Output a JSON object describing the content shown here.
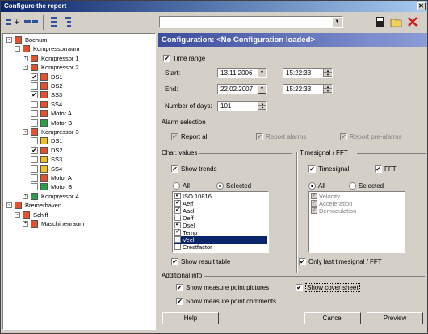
{
  "window": {
    "title": "Configure the report"
  },
  "toolbar": {
    "config_combo_value": "",
    "icons": [
      "add-items-icon",
      "remove-items-icon",
      "expand-tree-icon",
      "collapse-tree-icon",
      "save-icon",
      "open-folder-icon",
      "delete-icon"
    ]
  },
  "tree": {
    "nodes": [
      {
        "label": "Bochum",
        "level": 0,
        "color": "#e8502c",
        "checkbox": null,
        "expander": "-"
      },
      {
        "label": "Kompressorraum",
        "level": 1,
        "color": "#e8502c",
        "checkbox": null,
        "expander": "-"
      },
      {
        "label": "Kompressor 1",
        "level": 2,
        "color": "#e8502c",
        "checkbox": null,
        "expander": "+"
      },
      {
        "label": "Kompressor 2",
        "level": 2,
        "color": "#e8502c",
        "checkbox": null,
        "expander": "-"
      },
      {
        "label": "DS1",
        "level": 3,
        "color": "#e8502c",
        "checkbox": true
      },
      {
        "label": "DS2",
        "level": 3,
        "color": "#e8502c",
        "checkbox": false
      },
      {
        "label": "SS3",
        "level": 3,
        "color": "#e8502c",
        "checkbox": true
      },
      {
        "label": "SS4",
        "level": 3,
        "color": "#e8502c",
        "checkbox": false
      },
      {
        "label": "Motor A",
        "level": 3,
        "color": "#e8502c",
        "checkbox": false
      },
      {
        "label": "Motor B",
        "level": 3,
        "color": "#28a048",
        "checkbox": false
      },
      {
        "label": "Kompressor 3",
        "level": 2,
        "color": "#e8502c",
        "checkbox": null,
        "expander": "-"
      },
      {
        "label": "DS1",
        "level": 3,
        "color": "#f0c020",
        "checkbox": false
      },
      {
        "label": "DS2",
        "level": 3,
        "color": "#e8502c",
        "checkbox": true
      },
      {
        "label": "SS3",
        "level": 3,
        "color": "#f0c020",
        "checkbox": false
      },
      {
        "label": "SS4",
        "level": 3,
        "color": "#f0c020",
        "checkbox": false
      },
      {
        "label": "Motor A",
        "level": 3,
        "color": "#e8502c",
        "checkbox": false
      },
      {
        "label": "Motor B",
        "level": 3,
        "color": "#28a048",
        "checkbox": false
      },
      {
        "label": "Kompressor 4",
        "level": 2,
        "color": "#28a048",
        "checkbox": null,
        "expander": "+"
      },
      {
        "label": "Bremerhaven",
        "level": 0,
        "color": "#e8502c",
        "checkbox": null,
        "expander": "-"
      },
      {
        "label": "Schiff",
        "level": 1,
        "color": "#e8502c",
        "checkbox": null,
        "expander": "-"
      },
      {
        "label": "Maschinenraum",
        "level": 2,
        "color": "#e8502c",
        "checkbox": null,
        "expander": "+"
      }
    ]
  },
  "config": {
    "header": "Configuration: <No Configuration loaded>",
    "time_range_label": "Time range",
    "time_range_checked": true,
    "start_label": "Start:",
    "start_date": "13.11.2006",
    "start_time": "15:22:33",
    "end_label": "End:",
    "end_date": "22.02.2007",
    "end_time": "15:22:33",
    "days_label": "Number of days:",
    "days_value": "101",
    "alarm_group": "Alarm selection",
    "report_all": "Report all",
    "report_alarms": "Report alarms",
    "report_prealarms": "Report pre-alarms",
    "char_group": "Char. values",
    "show_trends": "Show trends",
    "char_all": "All",
    "char_selected": "Selected",
    "char_items": [
      {
        "label": "ISO 10816",
        "checked": true,
        "selected": false
      },
      {
        "label": "Aeff",
        "checked": true,
        "selected": false
      },
      {
        "label": "Aacl",
        "checked": true,
        "selected": false
      },
      {
        "label": "Deff",
        "checked": false,
        "selected": false
      },
      {
        "label": "Dsel",
        "checked": true,
        "selected": false
      },
      {
        "label": "Temp",
        "checked": true,
        "selected": false
      },
      {
        "label": "Veel",
        "checked": false,
        "selected": true
      },
      {
        "label": "Crestfactor",
        "checked": false,
        "selected": false
      }
    ],
    "show_result_table": "Show result table",
    "ts_group": "Timesignal / FFT",
    "timesignal": "Timesignal",
    "fft": "FFT",
    "ts_all": "All",
    "ts_selected": "Selected",
    "ts_items": [
      "Velocity",
      "Acceleration",
      "Demodulation"
    ],
    "only_last": "Only last timesignal / FFT",
    "addl_group": "Additional info",
    "show_pictures": "Show measure point pictures",
    "show_cover": "Show cover sheet",
    "show_comments": "Show measure point comments"
  },
  "buttons": {
    "help": "Help",
    "cancel": "Cancel",
    "preview": "Preview"
  },
  "colors": {
    "title_start": "#0a246a",
    "config_header": "#3c4c9c",
    "selection": "#0a246a",
    "red": "#e8502c",
    "green": "#28a048",
    "yellow": "#f0c020"
  }
}
